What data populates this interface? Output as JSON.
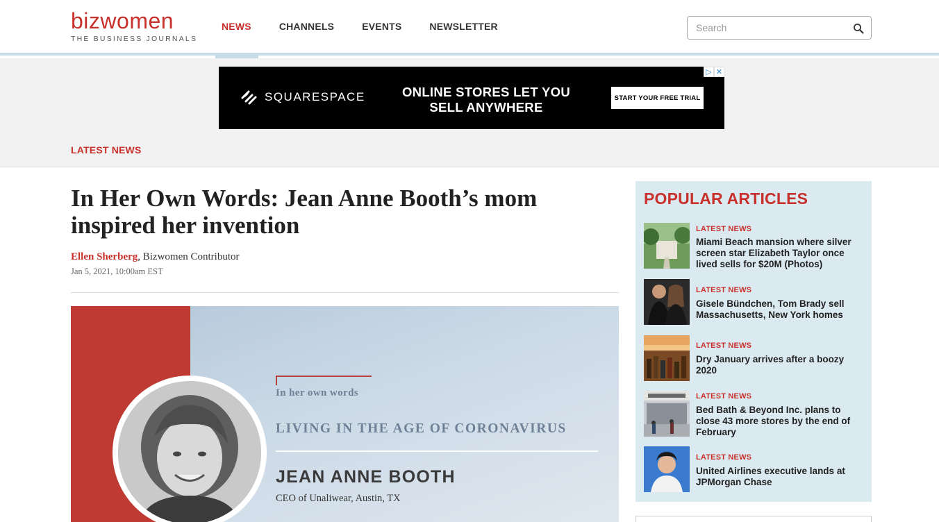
{
  "header": {
    "logo_biz": "biz",
    "logo_women": "women",
    "logo_tagline": "THE BUSINESS JOURNALS",
    "nav": [
      {
        "label": "NEWS",
        "active": true
      },
      {
        "label": "CHANNELS",
        "active": false
      },
      {
        "label": "EVENTS",
        "active": false
      },
      {
        "label": "NEWSLETTER",
        "active": false
      }
    ],
    "search_placeholder": "Search",
    "search_icon": "magnifier-icon"
  },
  "ad": {
    "brand": "SQUARESPACE",
    "headline": "ONLINE STORES LET YOU SELL ANYWHERE",
    "cta": "START YOUR FREE TRIAL",
    "adchoices_play": "▷",
    "adchoices_close": "✕"
  },
  "section_label": "LATEST NEWS",
  "article": {
    "title": "In Her Own Words: Jean Anne Booth’s mom inspired her invention",
    "author": "Ellen Sherberg",
    "author_role": ", Bizwomen Contributor",
    "date": "Jan 5, 2021, 10:00am EST",
    "hero": {
      "series": "In her own words",
      "topic": "LIVING IN THE AGE OF CORONAVIRUS",
      "name": "JEAN ANNE BOOTH",
      "role": "CEO of Unaliwear, Austin, TX"
    }
  },
  "sidebar": {
    "title": "POPULAR ARTICLES",
    "items": [
      {
        "category": "LATEST NEWS",
        "headline": "Miami Beach mansion where silver screen star Elizabeth Taylor once lived sells for $20M (Photos)",
        "thumb": "mansion-photo"
      },
      {
        "category": "LATEST NEWS",
        "headline": "Gisele Bündchen, Tom Brady sell Massachusetts, New York homes",
        "thumb": "couple-photo"
      },
      {
        "category": "LATEST NEWS",
        "headline": "Dry January arrives after a boozy 2020",
        "thumb": "bottles-photo"
      },
      {
        "category": "LATEST NEWS",
        "headline": "Bed Bath & Beyond Inc. plans to close 43 more stores by the end of February",
        "thumb": "storefront-photo"
      },
      {
        "category": "LATEST NEWS",
        "headline": "United Airlines executive lands at JPMorgan Chase",
        "thumb": "portrait-photo"
      }
    ]
  },
  "colors": {
    "brand_red": "#c8312b",
    "nav_accent": "#c5dbe6",
    "sidebar_bg": "#dbe9f0"
  }
}
